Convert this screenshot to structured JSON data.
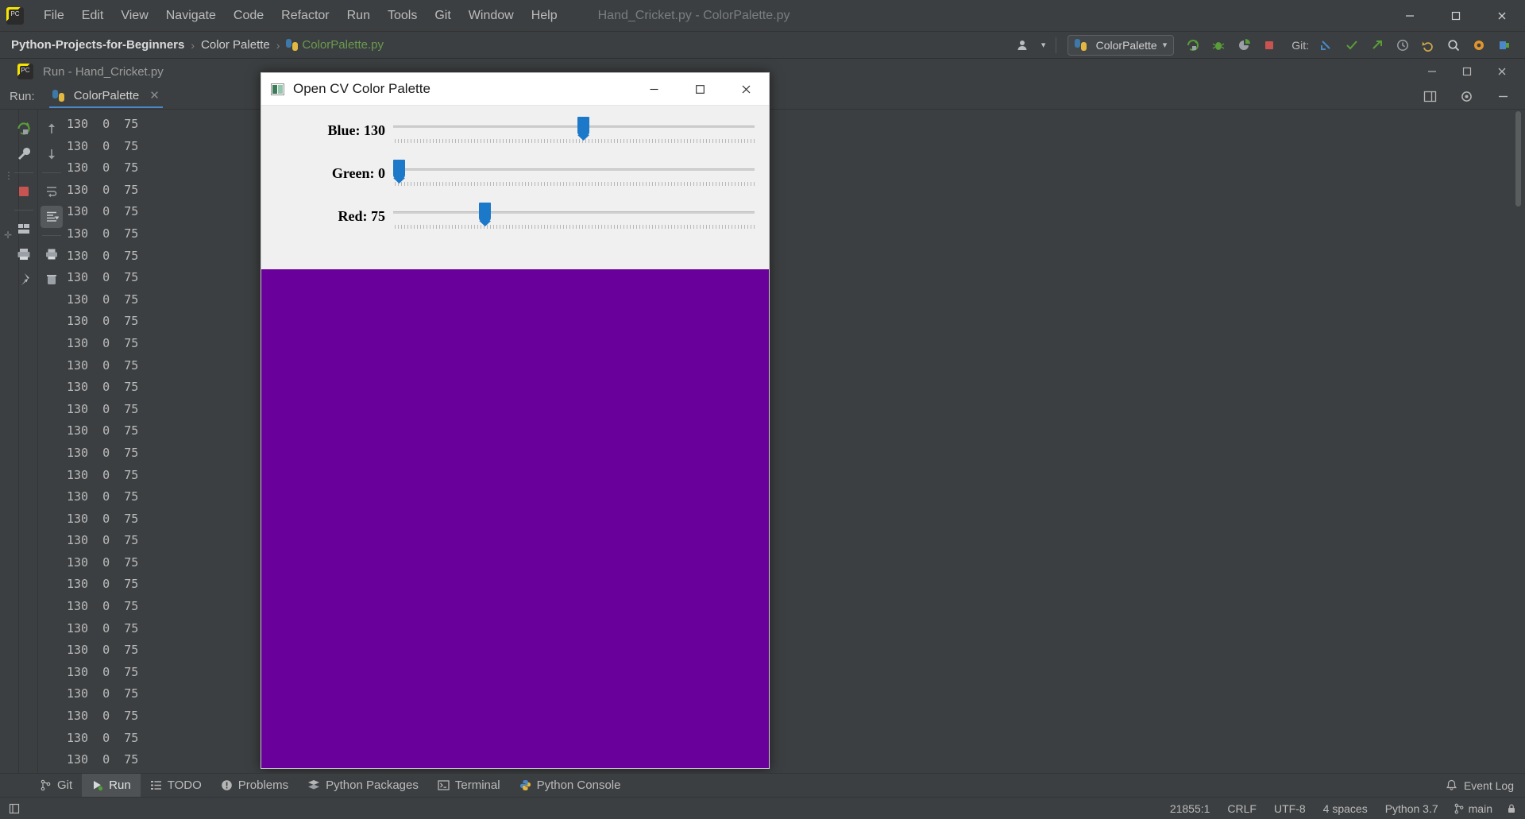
{
  "window": {
    "title": "Hand_Cricket.py - ColorPalette.py",
    "minimize_label": "–",
    "maximize_label": "❐",
    "close_label": "✕"
  },
  "menubar": {
    "items": [
      {
        "label": "File"
      },
      {
        "label": "Edit"
      },
      {
        "label": "View"
      },
      {
        "label": "Navigate"
      },
      {
        "label": "Code"
      },
      {
        "label": "Refactor"
      },
      {
        "label": "Run"
      },
      {
        "label": "Tools"
      },
      {
        "label": "Git"
      },
      {
        "label": "Window"
      },
      {
        "label": "Help"
      }
    ]
  },
  "breadcrumb": {
    "project": "Python-Projects-for-Beginners",
    "folder": "Color Palette",
    "file": "ColorPalette.py",
    "separator": "›"
  },
  "toolbar": {
    "run_config_label": "ColorPalette",
    "run_config_caret": "▾",
    "account_caret": "▾",
    "git_label": "Git:",
    "icons": [
      "account-icon",
      "run-icon",
      "debug-icon",
      "coverage-icon",
      "stop-icon",
      "git-update-icon",
      "git-commit-icon",
      "git-push-icon",
      "history-icon",
      "undo-icon",
      "search-icon",
      "settings-icon",
      "plugin-icon"
    ]
  },
  "run_tool_window": {
    "header_title": "Run - Hand_Cricket.py",
    "run_label": "Run:",
    "tab_label": "ColorPalette",
    "tab_close": "✕",
    "minimize_label": "–",
    "maximize_label": "❐",
    "close_label": "✕",
    "settings_icon": "gear-icon",
    "layout_icon": "layout-icon",
    "side_tools": [
      "rerun-icon",
      "configure-icon",
      "stop-icon",
      "pin-tab-icon",
      "pin-icon"
    ],
    "side_tools_2": [
      "up-arrow-icon",
      "down-arrow-icon",
      "soft-wrap-icon",
      "scroll-to-end-icon",
      "print-icon",
      "clear-all-icon"
    ],
    "console_lines": [
      "130  0  75",
      "130  0  75",
      "130  0  75",
      "130  0  75",
      "130  0  75",
      "130  0  75",
      "130  0  75",
      "130  0  75",
      "130  0  75",
      "130  0  75",
      "130  0  75",
      "130  0  75",
      "130  0  75",
      "130  0  75",
      "130  0  75",
      "130  0  75",
      "130  0  75",
      "130  0  75",
      "130  0  75",
      "130  0  75",
      "130  0  75",
      "130  0  75",
      "130  0  75",
      "130  0  75",
      "130  0  75",
      "130  0  75",
      "130  0  75",
      "130  0  75",
      "130  0  75",
      "130  0  75",
      "130  0  75"
    ]
  },
  "cv_window": {
    "title": "Open CV Color Palette",
    "icon": "opencv-image-icon",
    "minimize_label": "─",
    "maximize_label": "☐",
    "close_label": "✕",
    "canvas_color": "#6a009c",
    "thumb_color": "#1c78c8",
    "sliders": [
      {
        "name": "Blue",
        "label": "Blue: 130",
        "value": 130,
        "max": 255,
        "thumb_pct": 51.0
      },
      {
        "name": "Green",
        "label": "Green: 0",
        "value": 0,
        "max": 255,
        "thumb_pct": 0.0
      },
      {
        "name": "Red",
        "label": "Red: 75",
        "value": 75,
        "max": 255,
        "thumb_pct": 23.8
      }
    ]
  },
  "bottom_bar": {
    "items": [
      {
        "label": "Git",
        "icon": "git-branch-icon",
        "active": false
      },
      {
        "label": "Run",
        "icon": "run-icon",
        "active": true
      },
      {
        "label": "TODO",
        "icon": "todo-icon",
        "active": false
      },
      {
        "label": "Problems",
        "icon": "problems-icon",
        "active": false
      },
      {
        "label": "Python Packages",
        "icon": "packages-icon",
        "active": false
      },
      {
        "label": "Terminal",
        "icon": "terminal-icon",
        "active": false
      },
      {
        "label": "Python Console",
        "icon": "python-console-icon",
        "active": false
      }
    ],
    "event_log": "Event Log",
    "event_log_icon": "bell-icon"
  },
  "statusbar": {
    "caret": "21855:1",
    "line_separator": "CRLF",
    "encoding": "UTF-8",
    "indent": "4 spaces",
    "interpreter": "Python 3.7",
    "branch": "main",
    "branch_icon": "git-branch-icon",
    "lock_icon": "lock-icon"
  }
}
